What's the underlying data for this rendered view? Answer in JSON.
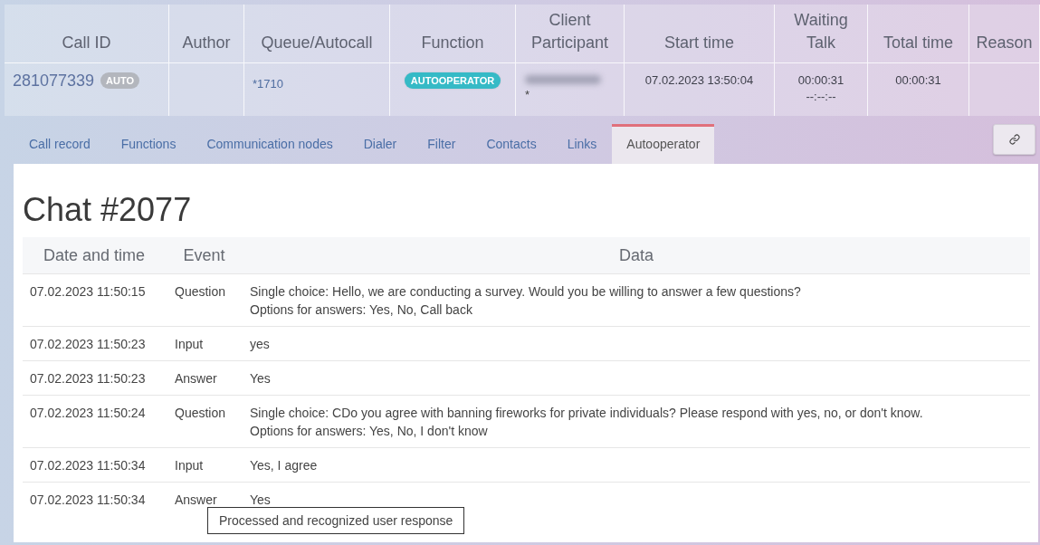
{
  "call_table": {
    "columns": [
      {
        "lines": [
          "Call ID"
        ]
      },
      {
        "lines": [
          "Author"
        ]
      },
      {
        "lines": [
          "Queue/Autocall"
        ]
      },
      {
        "lines": [
          "Function"
        ]
      },
      {
        "lines": [
          "Client",
          "Participant"
        ]
      },
      {
        "lines": [
          "Start time"
        ]
      },
      {
        "lines": [
          "Waiting",
          "Talk"
        ]
      },
      {
        "lines": [
          "Total time"
        ]
      },
      {
        "lines": [
          "Reason"
        ]
      }
    ],
    "row": {
      "call_id": "281077339",
      "call_badge": "AUTO",
      "queue": "*1710",
      "function": "AUTOOPERATOR",
      "client": {
        "blurred": true
      },
      "participant": "*",
      "start_time": "07.02.2023 13:50:04",
      "waiting": "00:00:31",
      "talk": "--:--:--",
      "total_time": "00:00:31"
    }
  },
  "tabs": [
    {
      "label": "Call record",
      "selected": false
    },
    {
      "label": "Functions",
      "selected": false
    },
    {
      "label": "Communication nodes",
      "selected": false
    },
    {
      "label": "Dialer",
      "selected": false
    },
    {
      "label": "Filter",
      "selected": false
    },
    {
      "label": "Contacts",
      "selected": false
    },
    {
      "label": "Links",
      "selected": false
    },
    {
      "label": "Autooperator",
      "selected": true
    }
  ],
  "chat": {
    "title": "Chat #2077",
    "columns": [
      "Date and time",
      "Event",
      "Data"
    ],
    "rows": [
      {
        "time": "07.02.2023 11:50:15",
        "event": "Question",
        "data": [
          "Single choice: Hello, we are conducting a survey. Would you be willing to answer a few questions?",
          "Options for answers: Yes, No, Call back"
        ]
      },
      {
        "time": "07.02.2023 11:50:23",
        "event": "Input",
        "data": [
          "yes"
        ]
      },
      {
        "time": "07.02.2023 11:50:23",
        "event": "Answer",
        "data": [
          "Yes"
        ]
      },
      {
        "time": "07.02.2023 11:50:24",
        "event": "Question",
        "data": [
          "Single choice: CDo you agree with banning fireworks for private individuals? Please respond with yes, no, or don't know.",
          "Options for answers: Yes, No, I don't know"
        ]
      },
      {
        "time": "07.02.2023 11:50:34",
        "event": "Input",
        "data": [
          "Yes, I agree"
        ]
      },
      {
        "time": "07.02.2023 11:50:34",
        "event": "Answer",
        "data": [
          "Yes"
        ]
      }
    ],
    "tooltip": "Processed and recognized user response"
  }
}
